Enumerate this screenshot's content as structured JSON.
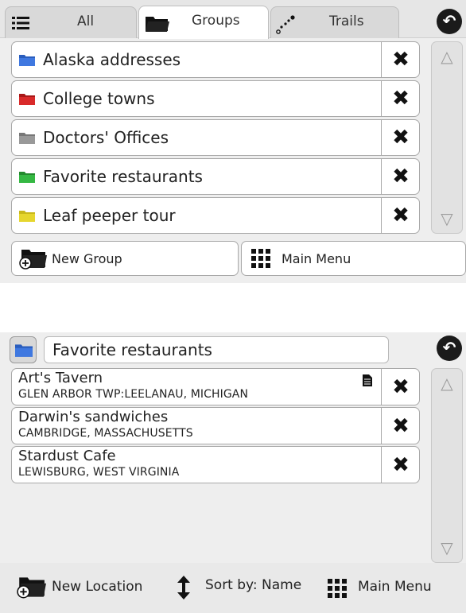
{
  "groups_panel": {
    "tabs": [
      {
        "label": "All",
        "icon": "list-icon"
      },
      {
        "label": "Groups",
        "icon": "folder-icon"
      },
      {
        "label": "Trails",
        "icon": "trail-icon"
      }
    ],
    "items": [
      {
        "label": "Alaska addresses",
        "folder_color": "#2a5dbd"
      },
      {
        "label": "College towns",
        "folder_color": "#c91f1f"
      },
      {
        "label": "Doctors' Offices",
        "folder_color": "#8a8a8a"
      },
      {
        "label": "Favorite restaurants",
        "folder_color": "#2fa83a"
      },
      {
        "label": "Leaf peeper tour",
        "folder_color": "#d8c91e"
      }
    ],
    "new_group_label": "New Group",
    "main_menu_label": "Main Menu"
  },
  "locations_panel": {
    "group_title": "Favorite restaurants",
    "group_color": "#2a5dbd",
    "items": [
      {
        "name": "Art's Tavern",
        "address": "GLEN ARBOR TWP:LEELANAU, MICHIGAN",
        "has_note": true
      },
      {
        "name": "Darwin's sandwiches",
        "address": "CAMBRIDGE, MASSACHUSETTS",
        "has_note": false
      },
      {
        "name": "Stardust Cafe",
        "address": "LEWISBURG, WEST VIRGINIA",
        "has_note": false
      }
    ],
    "new_location_label": "New Location",
    "sort_label": "Sort by: Name",
    "main_menu_label": "Main Menu"
  }
}
